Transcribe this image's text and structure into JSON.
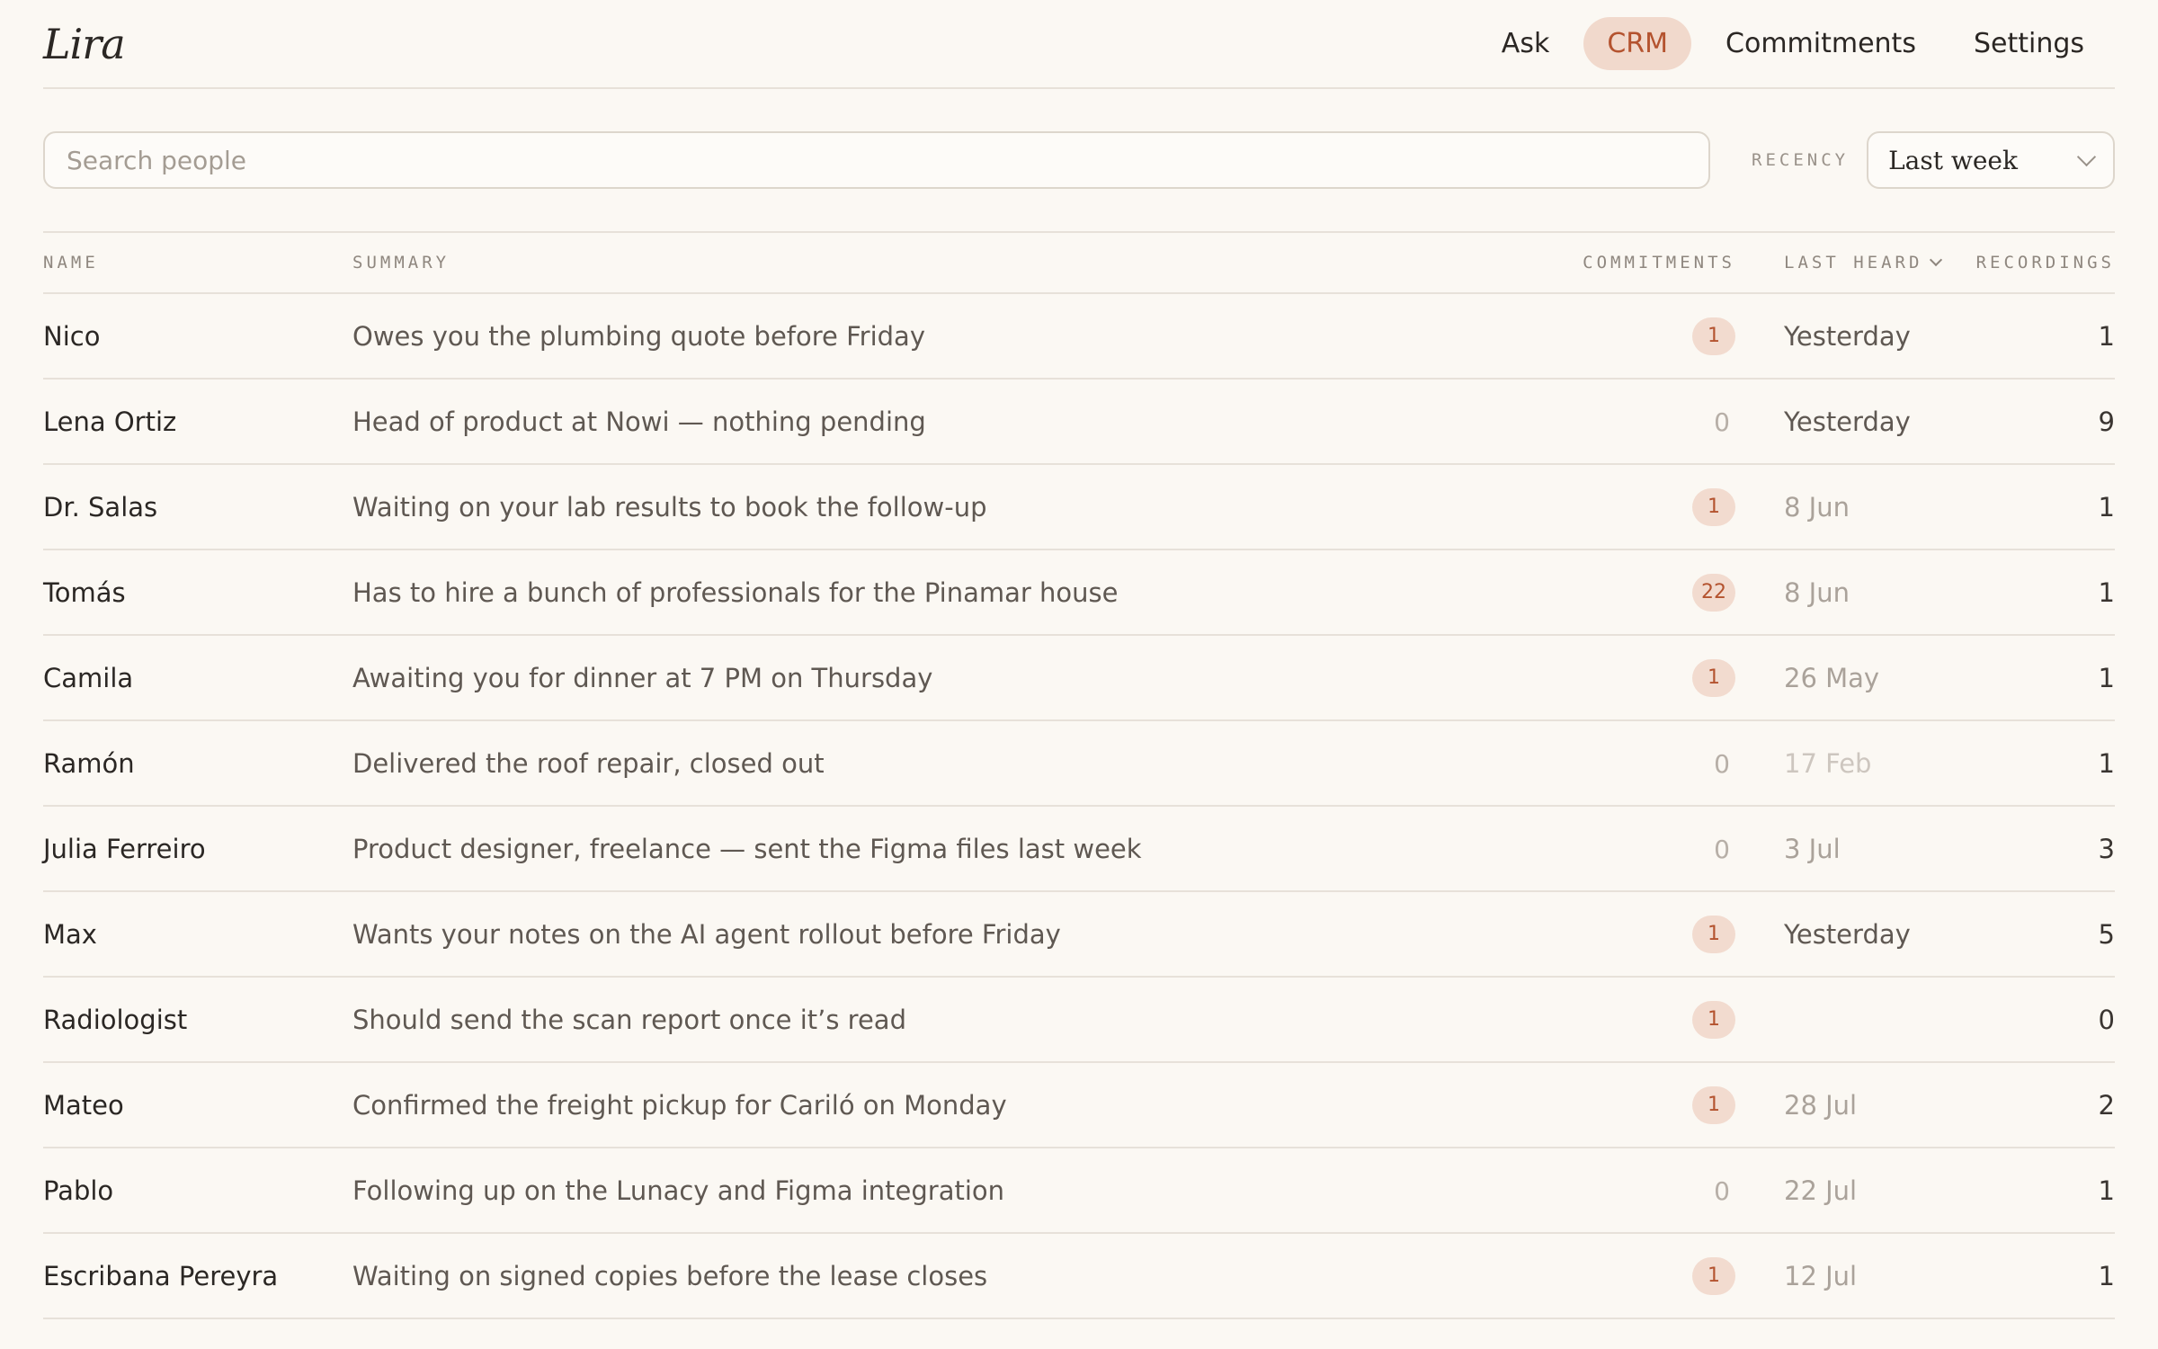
{
  "app": {
    "logo": "Lira"
  },
  "nav": [
    {
      "label": "Ask",
      "active": false
    },
    {
      "label": "CRM",
      "active": true
    },
    {
      "label": "Commitments",
      "active": false
    },
    {
      "label": "Settings",
      "active": false
    }
  ],
  "search": {
    "placeholder": "Search people",
    "value": ""
  },
  "recency": {
    "label": "RECENCY",
    "selected": "Last week"
  },
  "table": {
    "headers": {
      "name": "NAME",
      "summary": "SUMMARY",
      "commitments": "COMMITMENTS",
      "last_heard": "LAST HEARD",
      "recordings": "RECORDINGS"
    },
    "rows": [
      {
        "name": "Nico",
        "summary": "Owes you the plumbing quote before Friday",
        "commitments": "1",
        "last_heard": "Yesterday",
        "recency": "recent",
        "recordings": "1"
      },
      {
        "name": "Lena Ortiz",
        "summary": "Head of product at Nowi — nothing pending",
        "commitments": "0",
        "last_heard": "Yesterday",
        "recency": "recent",
        "recordings": "9"
      },
      {
        "name": "Dr. Salas",
        "summary": "Waiting on your lab results to book the follow-up",
        "commitments": "1",
        "last_heard": "8 Jun",
        "recency": "mid",
        "recordings": "1"
      },
      {
        "name": "Tomás",
        "summary": "Has to hire a bunch of professionals for the Pinamar house",
        "commitments": "22",
        "last_heard": "8 Jun",
        "recency": "mid",
        "recordings": "1"
      },
      {
        "name": "Camila",
        "summary": "Awaiting you for dinner at 7 PM on Thursday",
        "commitments": "1",
        "last_heard": "26 May",
        "recency": "mid",
        "recordings": "1"
      },
      {
        "name": "Ramón",
        "summary": "Delivered the roof repair, closed out",
        "commitments": "0",
        "last_heard": "17 Feb",
        "recency": "old",
        "recordings": "1"
      },
      {
        "name": "Julia Ferreiro",
        "summary": "Product designer, freelance — sent the Figma files last week",
        "commitments": "0",
        "last_heard": "3 Jul",
        "recency": "mid",
        "recordings": "3"
      },
      {
        "name": "Max",
        "summary": "Wants your notes on the AI agent rollout before Friday",
        "commitments": "1",
        "last_heard": "Yesterday",
        "recency": "recent",
        "recordings": "5"
      },
      {
        "name": "Radiologist",
        "summary": "Should send the scan report once it’s read",
        "commitments": "1",
        "last_heard": "",
        "recency": "mid",
        "recordings": "0"
      },
      {
        "name": "Mateo",
        "summary": "Confirmed the freight pickup for Cariló on Monday",
        "commitments": "1",
        "last_heard": "28 Jul",
        "recency": "mid",
        "recordings": "2"
      },
      {
        "name": "Pablo",
        "summary": "Following up on the Lunacy and Figma integration",
        "commitments": "0",
        "last_heard": "22 Jul",
        "recency": "mid",
        "recordings": "1"
      },
      {
        "name": "Escribana Pereyra",
        "summary": "Waiting on signed copies before the lease closes",
        "commitments": "1",
        "last_heard": "12 Jul",
        "recency": "mid",
        "recordings": "1"
      }
    ]
  },
  "colors": {
    "background": "#fbf8f3",
    "accent": "#b4532f",
    "accent_bg": "#f1d9cc"
  }
}
